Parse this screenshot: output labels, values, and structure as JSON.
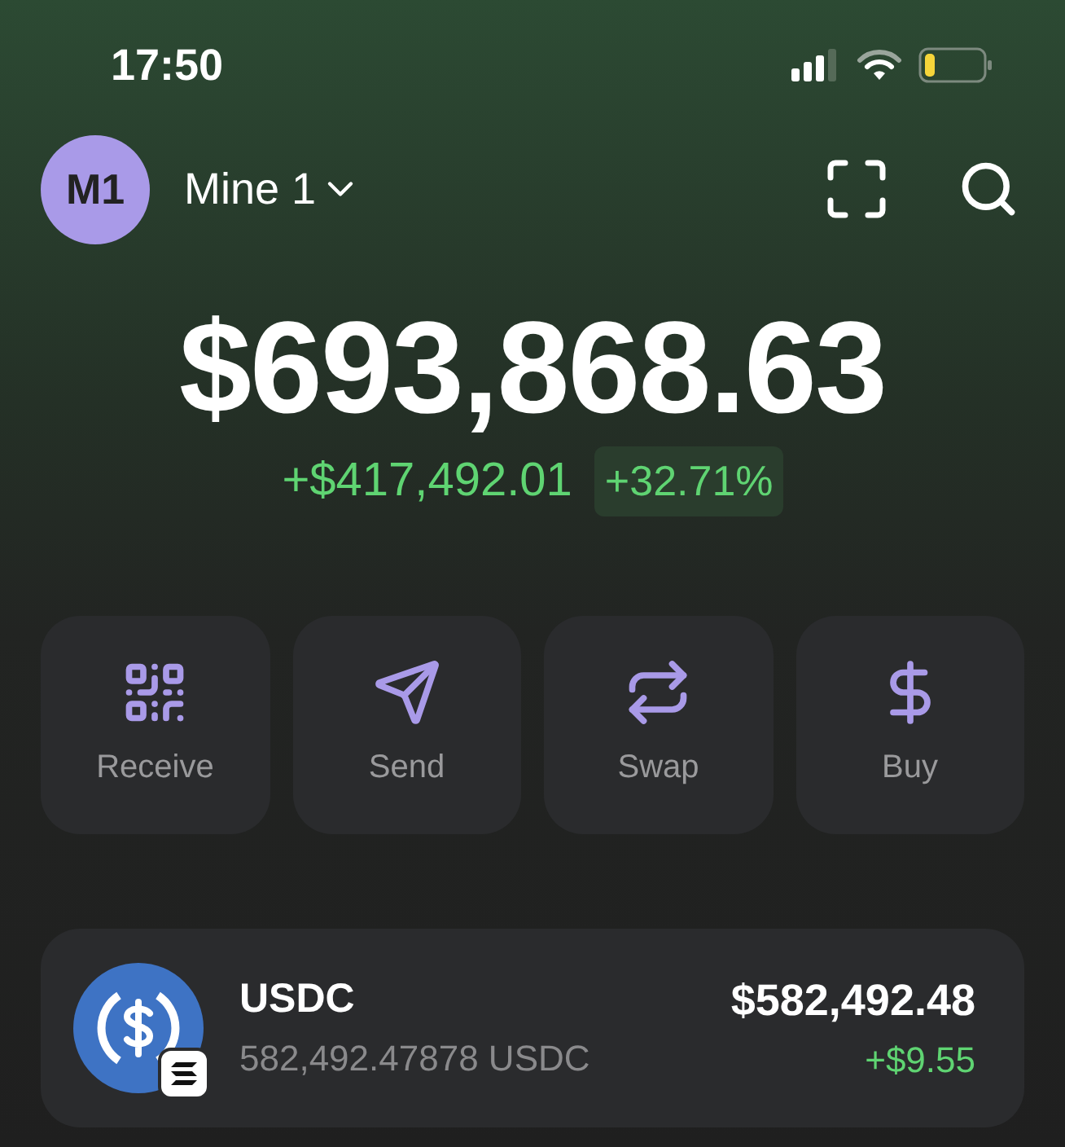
{
  "status_bar": {
    "time": "17:50"
  },
  "header": {
    "avatar": "M1",
    "account": "Mine 1"
  },
  "balance": {
    "total": "$693,868.63",
    "change": "+$417,492.01",
    "change_percent": "+32.71%"
  },
  "actions": [
    {
      "kind": "receive",
      "label": "Receive"
    },
    {
      "kind": "send",
      "label": "Send"
    },
    {
      "kind": "swap",
      "label": "Swap"
    },
    {
      "kind": "buy",
      "label": "Buy"
    }
  ],
  "tokens": [
    {
      "name": "USDC",
      "amount": "582,492.47878 USDC",
      "value": "$582,492.48",
      "change": "+$9.55"
    }
  ]
}
